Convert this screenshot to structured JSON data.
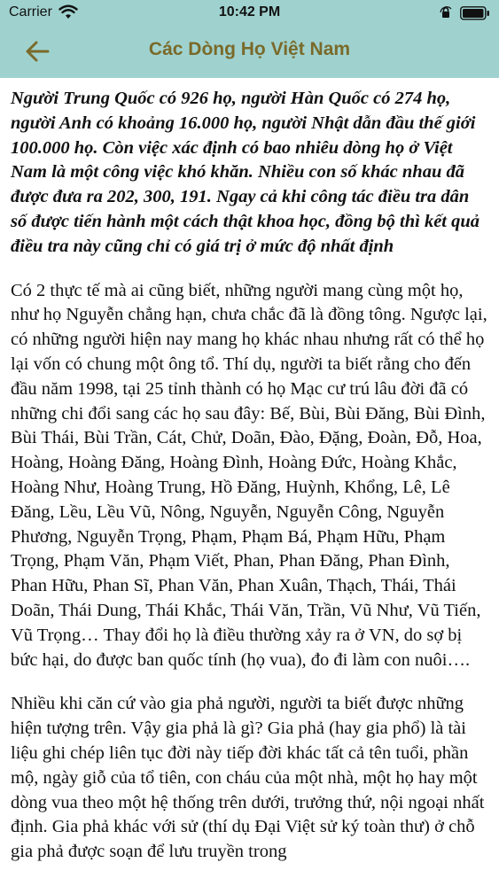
{
  "status_bar": {
    "carrier": "Carrier",
    "time": "10:42 PM"
  },
  "nav": {
    "title": "Các Dòng Họ Việt Nam",
    "back_icon": "arrow-left-icon",
    "accent_color": "#7a6a2a",
    "header_color": "#9fd2cf"
  },
  "article": {
    "intro": "Người Trung Quốc có 926 họ, người Hàn Quốc có 274 họ, người Anh có khoảng 16.000 họ, người Nhật dẫn đầu thế giới 100.000 họ. Còn việc xác định có bao nhiêu dòng họ ở Việt Nam là một công việc khó khăn. Nhiều con số khác nhau đã được đưa ra 202, 300, 191. Ngay cả khi công tác điều tra dân số được tiến hành một cách thật khoa học, đồng bộ thì kết quả điều tra này cũng chỉ có giá trị ở mức độ nhất định",
    "paragraph_1": "Có 2 thực tế mà ai cũng biết, những người mang cùng một họ, như họ Nguyễn chẳng hạn, chưa chắc đã là đồng tông. Ngược lại, có những người hiện nay mang họ khác nhau nhưng rất có thể họ lại vốn có chung một ông tổ. Thí dụ, người ta biết rằng cho đến đầu năm 1998, tại 25 tỉnh thành có họ Mạc cư trú lâu đời đã có những chi đổi sang các họ sau đây: Bế, Bùi, Bùi Đăng, Bùi Đình, Bùi Thái, Bùi Trần, Cát, Chử, Doãn, Đào, Đặng, Đoàn, Đỗ, Hoa, Hoàng, Hoàng Đăng, Hoàng Đình, Hoàng Đức, Hoàng Khắc, Hoàng Như, Hoàng Trung, Hồ Đăng, Huỳnh, Khổng, Lê, Lê Đăng, Lều, Lều Vũ, Nông, Nguyễn, Nguyễn Công, Nguyễn Phương, Nguyễn Trọng, Phạm, Phạm Bá, Phạm Hữu, Phạm Trọng, Phạm Văn, Phạm Viết, Phan, Phan Đăng, Phan Đình, Phan Hữu, Phan Sĩ, Phan Văn, Phan Xuân, Thạch, Thái, Thái Doãn, Thái Dung, Thái Khắc, Thái Văn, Trần, Vũ Như, Vũ Tiến, Vũ Trọng… Thay đổi họ là điều thường xảy ra ở VN, do sợ bị bức hại, do được ban quốc tính (họ vua), đo đi làm con nuôi….",
    "paragraph_2": "Nhiều khi căn cứ vào gia phả người, người ta biết được những hiện tượng trên. Vậy gia phả là gì? Gia phả (hay gia phổ) là tài liệu ghi chép liên tục đời này tiếp đời khác tất cả tên tuổi, phần mộ, ngày giỗ của tổ tiên, con cháu của một nhà, một họ hay một dòng vua theo một hệ thống trên dưới, trưởng thứ, nội ngoại nhất định. Gia phả khác với sử (thí dụ Đại Việt sử ký toàn thư) ở chỗ gia phả được soạn để lưu truyền trong"
  }
}
